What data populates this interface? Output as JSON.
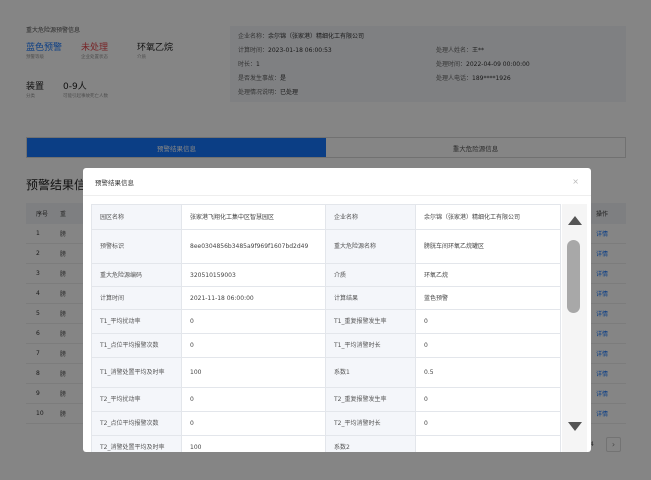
{
  "header": {
    "title": "重大危险源预警信息",
    "stats": [
      {
        "value": "蓝色预警",
        "label": "预警等级",
        "color": "#1677ff"
      },
      {
        "value": "未处理",
        "label": "企业处置状态",
        "color": "#e5484d"
      },
      {
        "value": "环氧乙烷",
        "label": "介质",
        "color": "#222222"
      },
      {
        "value": "装置",
        "label": "分类",
        "color": "#222222"
      },
      {
        "value": "0-9人",
        "label": "可能引起事故死亡人数",
        "color": "#222222"
      }
    ]
  },
  "info": {
    "enterprise_label": "企业名称：",
    "enterprise": "余尔锦（张家港）精细化工有限公司",
    "calc_time_label": "计算时间：",
    "calc_time": "2023-01-18 06:00:53",
    "duration_label": "时长：",
    "duration": "1",
    "accident_label": "是否发生事故：",
    "accident": "是",
    "status_label": "处理情况说明：",
    "status": "已处理",
    "handler_label": "处理人姓名：",
    "handler": "王**",
    "handle_time_label": "处理时间：",
    "handle_time": "2022-04-09 00:00:00",
    "phone_label": "处理人电话：",
    "phone": "189****1926"
  },
  "tabs": [
    {
      "label": "预警结果信息",
      "active": true
    },
    {
      "label": "重大危险源信息",
      "active": false
    }
  ],
  "section_title": "预警结果信",
  "bg_table": {
    "head": {
      "idx": "序号",
      "name": "重",
      "op": "操作"
    },
    "rows": [
      {
        "idx": "1",
        "name": "膀",
        "op": "详情"
      },
      {
        "idx": "2",
        "name": "膀",
        "op": "详情"
      },
      {
        "idx": "3",
        "name": "膀",
        "op": "详情"
      },
      {
        "idx": "4",
        "name": "膀",
        "op": "详情"
      },
      {
        "idx": "5",
        "name": "膀",
        "op": "详情"
      },
      {
        "idx": "6",
        "name": "膀",
        "op": "详情"
      },
      {
        "idx": "7",
        "name": "膀",
        "op": "详情"
      },
      {
        "idx": "8",
        "name": "膀",
        "op": "详情"
      },
      {
        "idx": "9",
        "name": "膀",
        "op": "详情"
      },
      {
        "idx": "10",
        "name": "膀",
        "op": "详情"
      }
    ],
    "page_label": "4",
    "next_glyph": "›"
  },
  "modal": {
    "title": "预警结果信息",
    "close_glyph": "×",
    "rows": [
      [
        "园区名称",
        "张家港飞翔化工集中区智慧园区",
        "企业名称",
        "余尔锦（张家港）精细化工有限公司"
      ],
      [
        "预警标识",
        "8ee0304856b3485a9f969f1607bd2d49",
        "重大危险源名称",
        "膀胱车间环氧乙烷罐区"
      ],
      [
        "重大危险源编码",
        "320510159003",
        "介质",
        "环氧乙烷"
      ],
      [
        "计算时间",
        "2021-11-18 06:00:00",
        "计算结果",
        "蓝色预警"
      ],
      [
        "T1_平均扰动率",
        "0",
        "T1_重复报警发生率",
        "0"
      ],
      [
        "T1_点位平均报警次数",
        "0",
        "T1_平均消警时长",
        "0"
      ],
      [
        "T1_消警处置平均及时率",
        "100",
        "系数1",
        "0.5"
      ],
      [
        "T2_平均扰动率",
        "0",
        "T2_重复报警发生率",
        "0"
      ],
      [
        "T2_点位平均报警次数",
        "0",
        "T2_平均消警时长",
        "0"
      ],
      [
        "T2_消警处置平均及时率",
        "100",
        "系数2",
        ""
      ]
    ]
  }
}
